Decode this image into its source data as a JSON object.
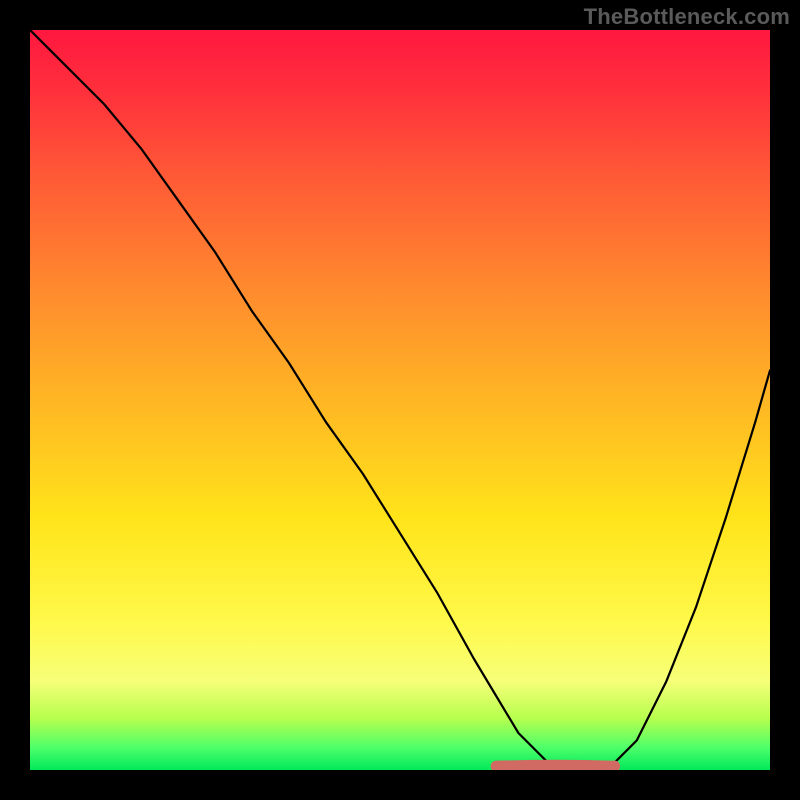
{
  "watermark": "TheBottleneck.com",
  "chart_data": {
    "type": "line",
    "title": "",
    "xlabel": "",
    "ylabel": "",
    "xlim": [
      0,
      100
    ],
    "ylim": [
      0,
      100
    ],
    "gradient_stops": [
      {
        "pct": 0,
        "color": "#ff173f"
      },
      {
        "pct": 8,
        "color": "#ff2f3c"
      },
      {
        "pct": 20,
        "color": "#ff5a36"
      },
      {
        "pct": 35,
        "color": "#ff8a2e"
      },
      {
        "pct": 50,
        "color": "#ffb624"
      },
      {
        "pct": 66,
        "color": "#ffe41a"
      },
      {
        "pct": 80,
        "color": "#fff94a"
      },
      {
        "pct": 88,
        "color": "#f6ff78"
      },
      {
        "pct": 93,
        "color": "#b7ff4e"
      },
      {
        "pct": 97,
        "color": "#4dff6a"
      },
      {
        "pct": 100,
        "color": "#00e85a"
      }
    ],
    "series": [
      {
        "name": "bottleneck-curve",
        "note": "y = 100 means top of plot; y = 0 means bottom (minimum bottleneck)",
        "x": [
          0,
          3,
          6,
          10,
          15,
          20,
          25,
          30,
          35,
          40,
          45,
          50,
          55,
          60,
          63,
          66,
          70,
          74,
          78,
          82,
          86,
          90,
          94,
          98,
          100
        ],
        "y": [
          100,
          97,
          94,
          90,
          84,
          77,
          70,
          62,
          55,
          47,
          40,
          32,
          24,
          15,
          10,
          5,
          1,
          0,
          0,
          4,
          12,
          22,
          34,
          47,
          54
        ]
      }
    ],
    "flat_highlight": {
      "name": "minimum-flat",
      "color": "#d16a62",
      "x_start": 63,
      "x_end": 79,
      "y": 0.5
    }
  }
}
